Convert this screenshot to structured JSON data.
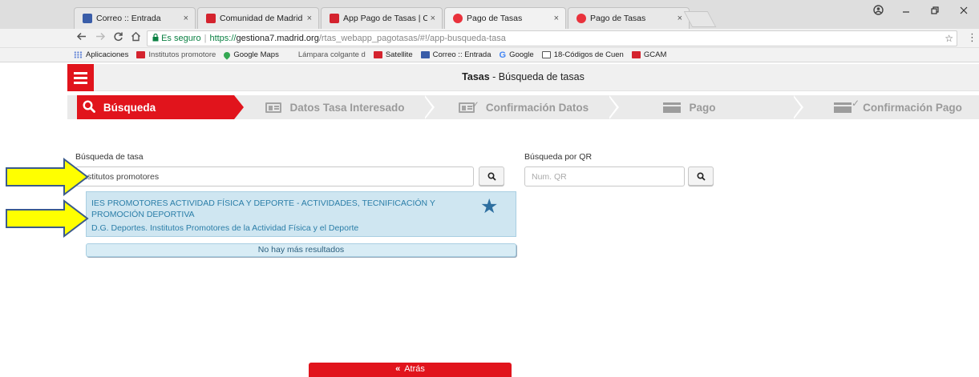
{
  "browser": {
    "tabs": [
      {
        "label": "Correo :: Entrada",
        "favicon": "mail-icon"
      },
      {
        "label": "Comunidad de Madrid",
        "favicon": "comunidad-madrid-icon"
      },
      {
        "label": "App Pago de Tasas | Com",
        "favicon": "comunidad-madrid-icon"
      },
      {
        "label": "Pago de Tasas",
        "favicon": "pago-tasas-icon"
      },
      {
        "label": "Pago de Tasas",
        "favicon": "pago-tasas-icon"
      }
    ],
    "close_glyph": "×",
    "secure_label": "Es seguro",
    "url_scheme": "https://",
    "url_host": "gestiona7.madrid.org",
    "url_path": "/rtas_webapp_pagotasas/#!/app-busqueda-tasa",
    "bookmarks": [
      {
        "label": "Aplicaciones",
        "icon": "apps-icon",
        "color": "#5b7fd6"
      },
      {
        "label": "Institutos promotore",
        "icon": "comunidad-madrid-icon",
        "color": "#d4232e"
      },
      {
        "label": "Google Maps",
        "icon": "maps-pin-icon",
        "color": "#34a853"
      },
      {
        "label": "Lámpara colgante d",
        "icon": "blank-page-icon",
        "color": ""
      },
      {
        "label": "Satellite",
        "icon": "comunidad-madrid-icon",
        "color": "#d4232e"
      },
      {
        "label": "Correo :: Entrada",
        "icon": "mail-icon",
        "color": "#3a5da8"
      },
      {
        "label": "Google",
        "icon": "google-g-icon",
        "color": "#4285f4"
      },
      {
        "label": "18-Códigos de Cuen",
        "icon": "pdf-icon",
        "color": "#555555"
      },
      {
        "label": "GCAM",
        "icon": "comunidad-madrid-icon",
        "color": "#d4232e"
      }
    ]
  },
  "app": {
    "title_bold": "Tasas",
    "title_rest": " - Búsqueda de tasas",
    "accent_color": "#e1141c",
    "steps": [
      {
        "label": "Búsqueda",
        "icon": "search-icon",
        "active": true
      },
      {
        "label": "Datos Tasa Interesado",
        "icon": "id-card-icon",
        "active": false
      },
      {
        "label": "Confirmación Datos",
        "icon": "id-card-check-icon",
        "active": false
      },
      {
        "label": "Pago",
        "icon": "credit-card-icon",
        "active": false
      },
      {
        "label": "Confirmación Pago",
        "icon": "credit-card-check-icon",
        "active": false
      }
    ],
    "search": {
      "label": "Búsqueda de tasa",
      "value": "nstitutos promotores",
      "results": [
        {
          "title": "IES PROMOTORES ACTIVIDAD FÍSICA Y DEPORTE - ACTIVIDADES, TECNIFICACIÓN Y PROMOCIÓN DEPORTIVA",
          "subtitle": "D.G. Deportes. Institutos Promotores de la Actividad Física y el Deporte",
          "favorite": true
        }
      ],
      "no_more_results": "No hay más resultados"
    },
    "qr": {
      "label": "Búsqueda por QR",
      "placeholder": "Num. QR",
      "value": ""
    },
    "back_label": "Atrás",
    "back_glyph": "«"
  }
}
